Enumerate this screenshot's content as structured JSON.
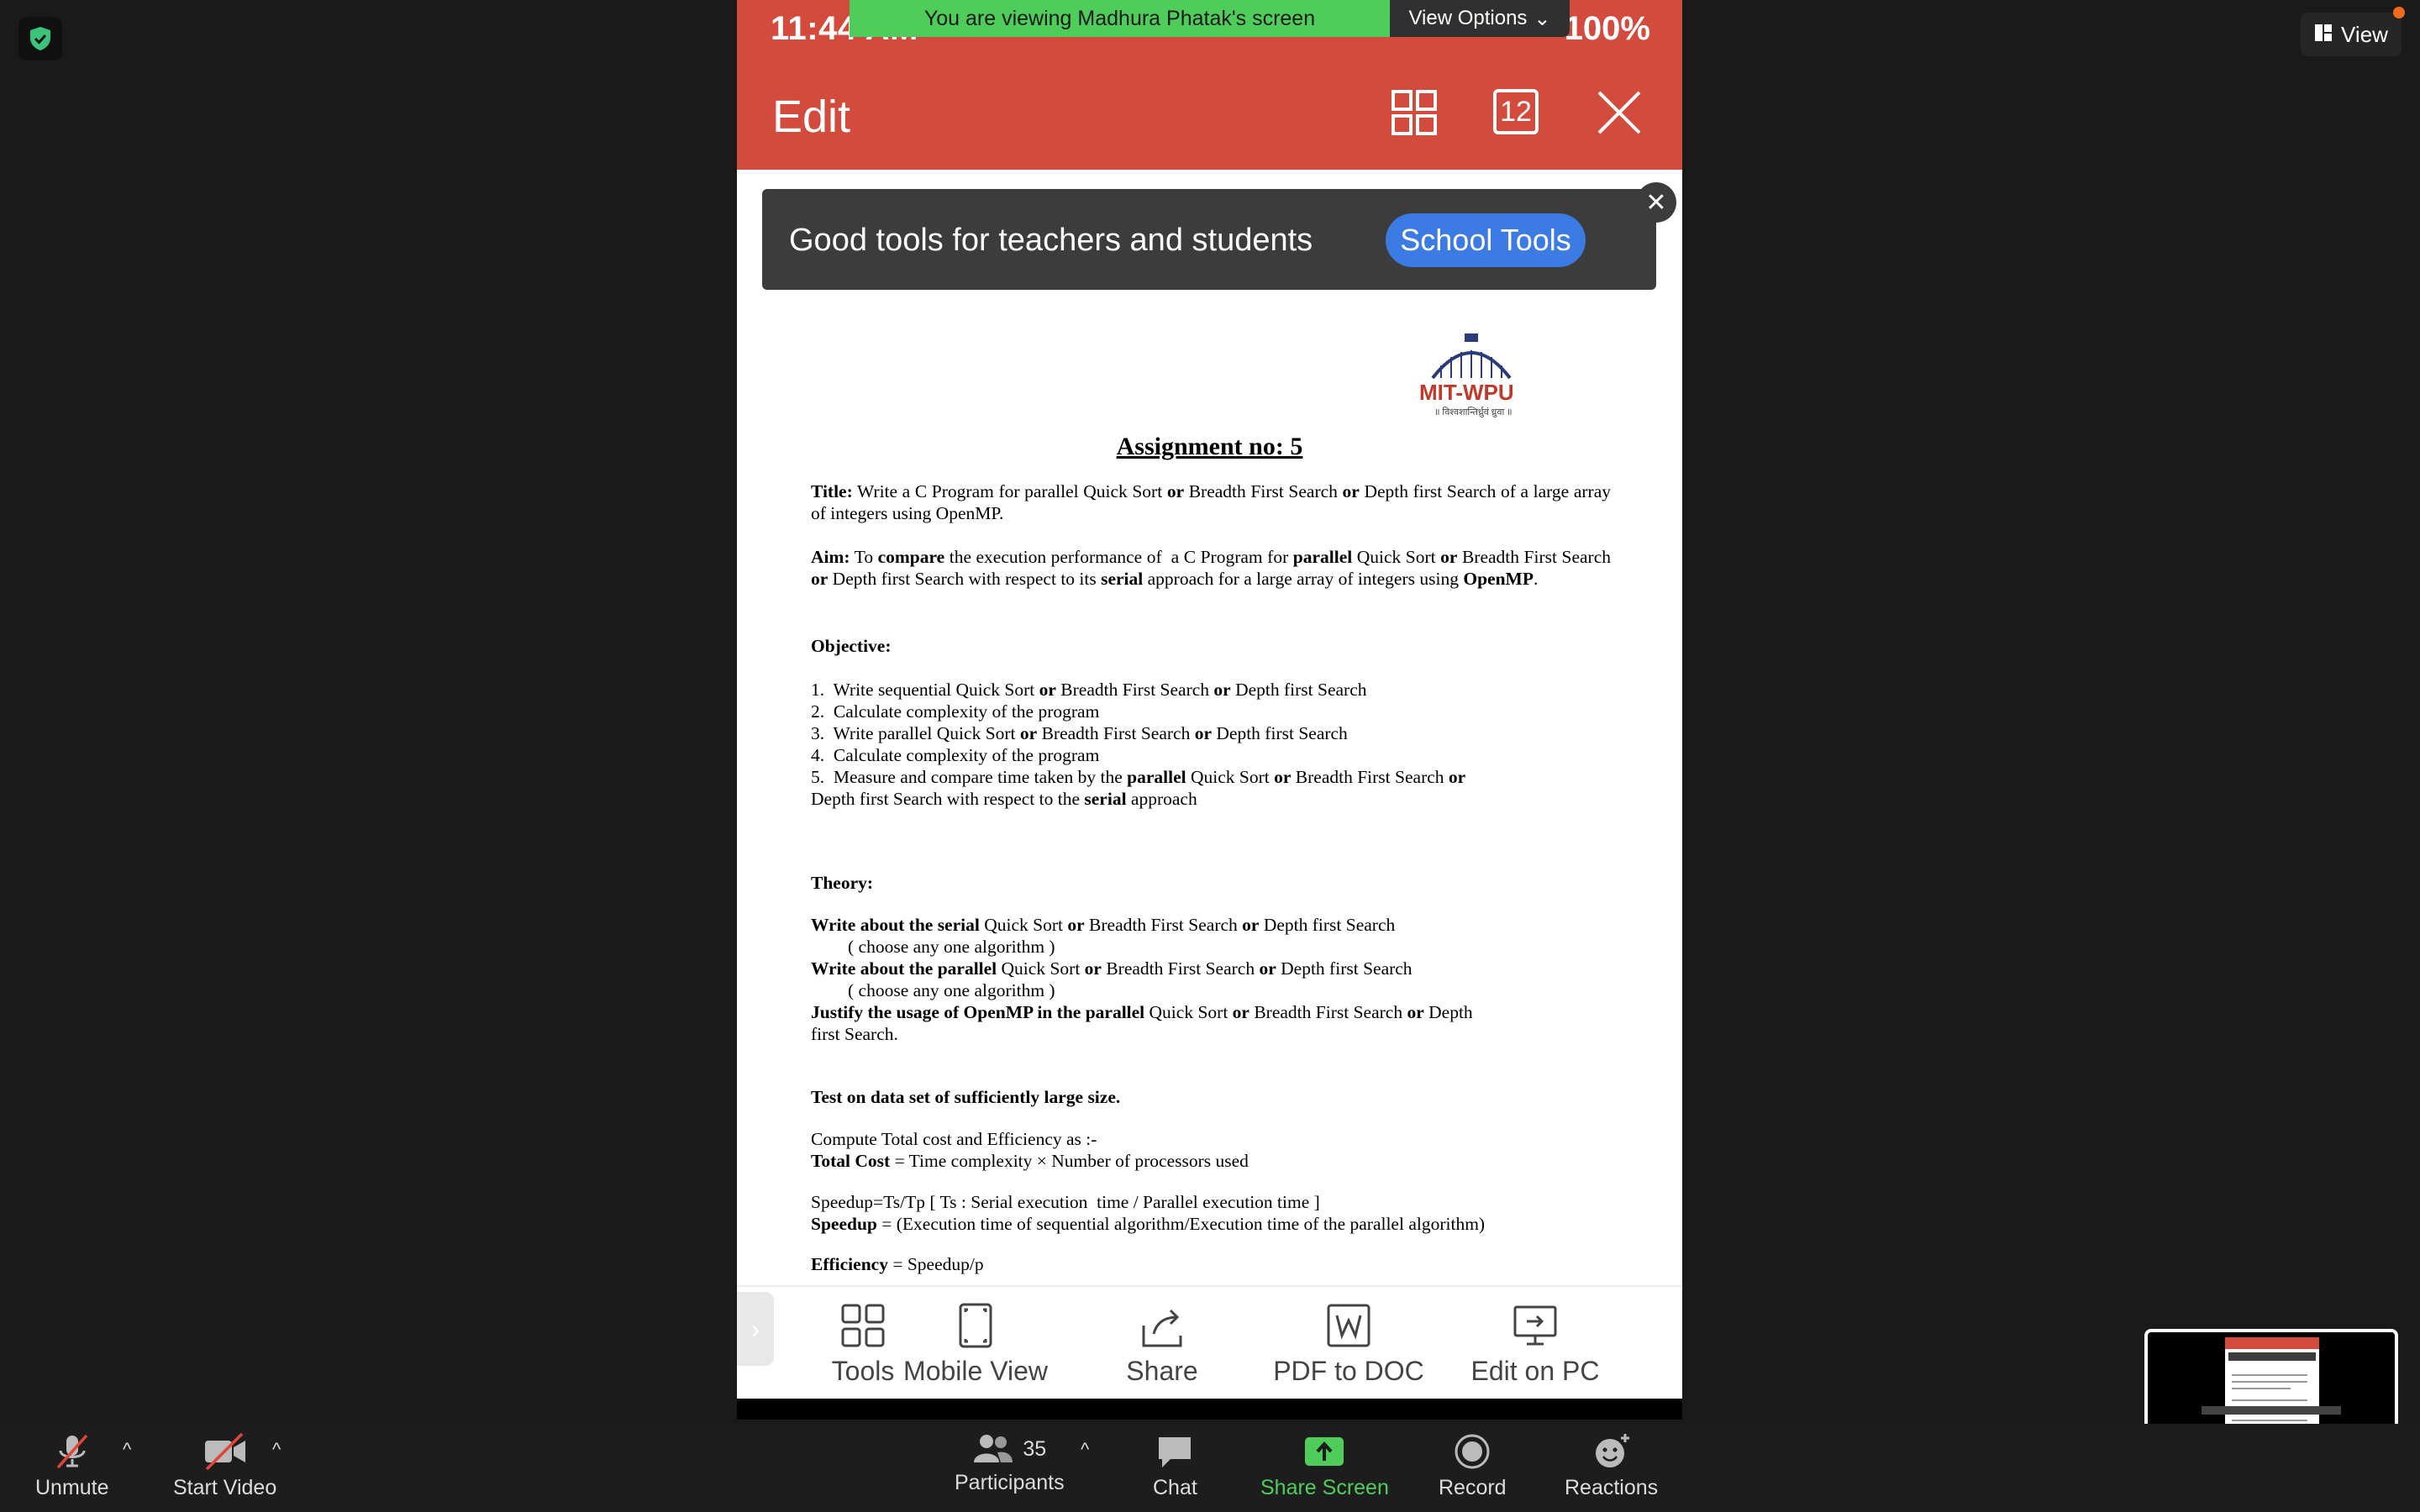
{
  "top": {
    "viewing_text": "You are viewing Madhura Phatak's screen",
    "view_options_label": "View Options",
    "view_button_label": "View"
  },
  "phone": {
    "status_time": "11:44 AM",
    "battery": "100%",
    "appbar_title": "Edit",
    "page_count": "12",
    "banner": {
      "text": "Good tools for teachers and students",
      "button": "School Tools"
    },
    "toolbar": [
      {
        "label": "Tools",
        "icon": "tools-icon"
      },
      {
        "label": "Mobile View",
        "icon": "mobile-view-icon"
      },
      {
        "label": "Share",
        "icon": "share-icon"
      },
      {
        "label": "PDF to DOC",
        "icon": "pdf-to-doc-icon"
      },
      {
        "label": "Edit on PC",
        "icon": "edit-on-pc-icon"
      }
    ]
  },
  "document": {
    "logo_text": "MIT-WPU",
    "logo_subtext": "॥ विश्वशान्तिर्ध्रुवं ध्रुवा ॥",
    "title": "Assignment no: 5"
  },
  "zoom_bar": {
    "unmute": "Unmute",
    "start_video": "Start Video",
    "participants": "Participants",
    "participant_count": "35",
    "chat": "Chat",
    "share_screen": "Share Screen",
    "record": "Record",
    "reactions": "Reactions"
  },
  "colors": {
    "app_red": "#d34b3c",
    "share_green": "#4fcd5b",
    "school_blue": "#3d7be4"
  }
}
